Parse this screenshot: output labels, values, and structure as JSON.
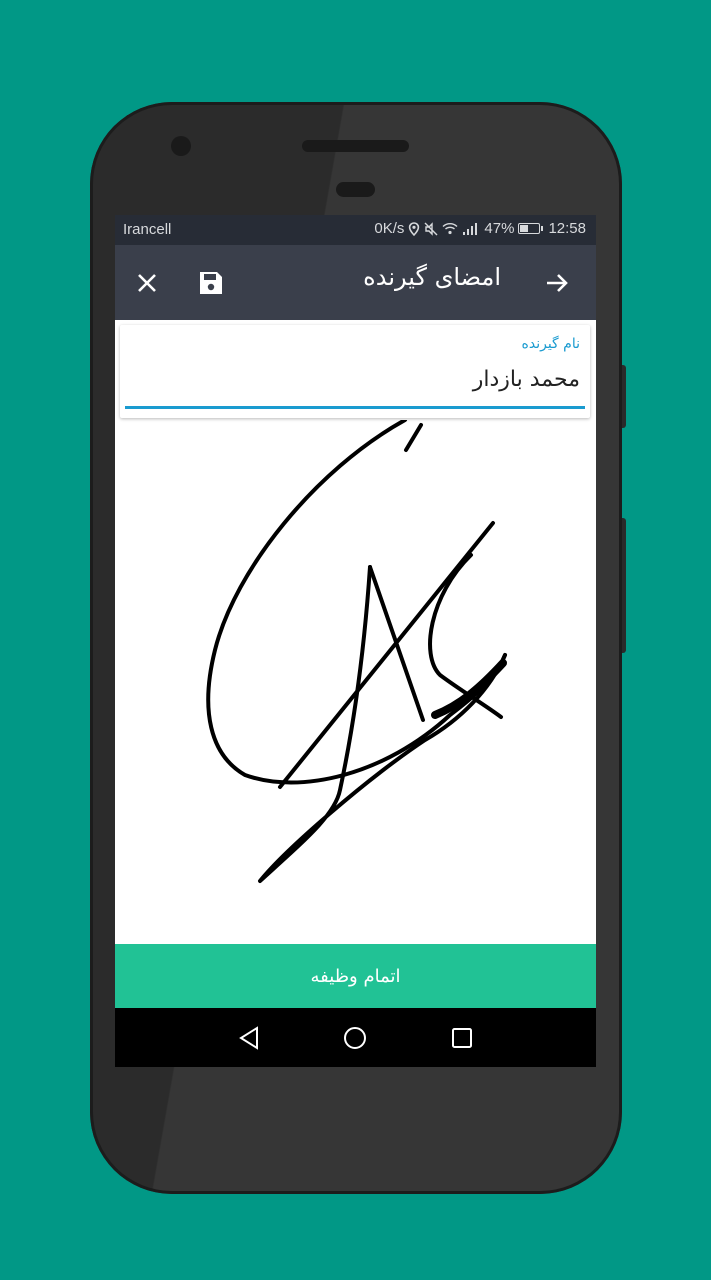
{
  "status_bar": {
    "carrier": "Irancell",
    "net_speed": "0K/s",
    "battery_percent": "47%",
    "battery_level": 0.47,
    "time": "12:58"
  },
  "toolbar": {
    "title": "امضای گیرنده",
    "close_icon": "close-icon",
    "save_icon": "save-icon",
    "back_icon": "arrow-right-icon"
  },
  "recipient": {
    "label": "نام گیرنده",
    "value": "محمد بازدار"
  },
  "actions": {
    "finish_label": "اتمام وظیفه"
  },
  "nav_bar": {
    "back_icon": "nav-back-icon",
    "home_icon": "nav-home-icon",
    "recents_icon": "nav-recents-icon"
  },
  "colors": {
    "background": "#019886",
    "toolbar": "#3a3f4b",
    "status_bar": "#272c36",
    "accent": "#1a9bd0",
    "finish_button": "#21c295"
  }
}
